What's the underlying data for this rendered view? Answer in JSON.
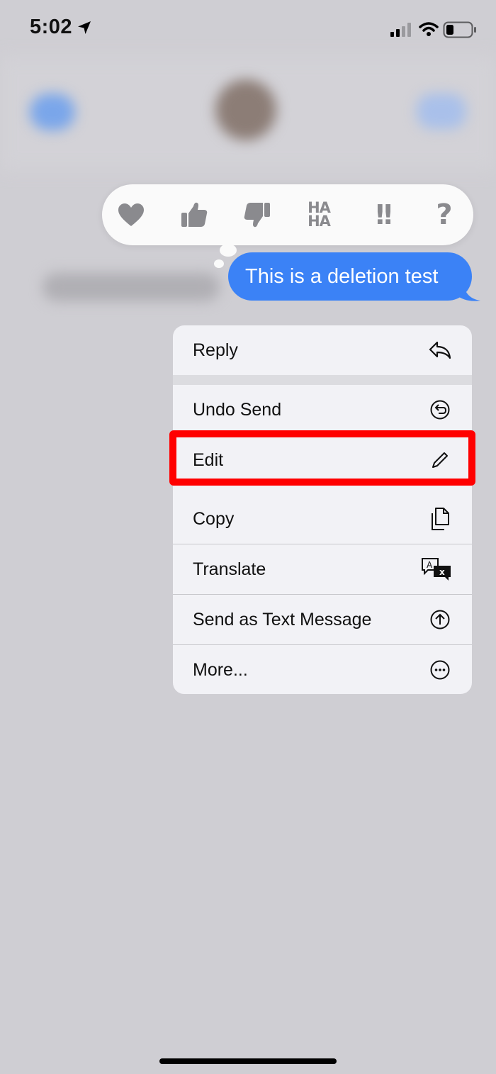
{
  "status_bar": {
    "time": "5:02",
    "icons": [
      "location-arrow-icon",
      "cellular-signal-icon",
      "wifi-icon",
      "battery-icon"
    ]
  },
  "reactions": [
    "heart-icon",
    "thumbs-up-icon",
    "thumbs-down-icon",
    "haha-icon",
    "exclamation-icon",
    "question-icon"
  ],
  "reaction_text": {
    "haha_top": "HA",
    "haha_bottom": "HA",
    "exclaim": "!!",
    "question": "?"
  },
  "message": {
    "text": "This is a deletion test",
    "bubble_color": "#3b82f6"
  },
  "context_menu": {
    "items": [
      {
        "label": "Reply",
        "icon": "reply-icon"
      },
      {
        "label": "Undo Send",
        "icon": "undo-icon"
      },
      {
        "label": "Edit",
        "icon": "pencil-icon"
      },
      {
        "label": "Copy",
        "icon": "copy-icon"
      },
      {
        "label": "Translate",
        "icon": "translate-icon"
      },
      {
        "label": "Send as Text Message",
        "icon": "arrow-up-circle-icon"
      },
      {
        "label": "More...",
        "icon": "ellipsis-circle-icon"
      }
    ]
  },
  "highlight": {
    "target": "Edit",
    "color": "#ff0000"
  }
}
